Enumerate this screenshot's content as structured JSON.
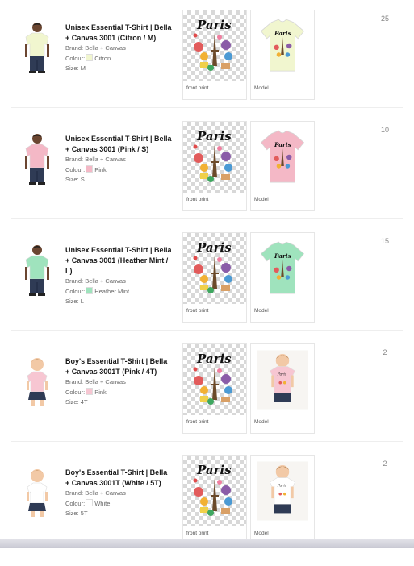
{
  "items": [
    {
      "title": "Unisex Essential T-Shirt | Bella + Canvas 3001 (Citron / M)",
      "brand_label": "Brand:",
      "brand": "Bella + Canvas",
      "colour_label": "Colour:",
      "colour": "Citron",
      "colour_hex": "#f1f6cf",
      "size_label": "Size:",
      "size": "M",
      "print_caption": "front print",
      "model_caption": "Model",
      "quantity": "25",
      "figure": "adult-male"
    },
    {
      "title": "Unisex Essential T-Shirt | Bella + Canvas 3001 (Pink / S)",
      "brand_label": "Brand:",
      "brand": "Bella + Canvas",
      "colour_label": "Colour:",
      "colour": "Pink",
      "colour_hex": "#f4b8c6",
      "size_label": "Size:",
      "size": "S",
      "print_caption": "front print",
      "model_caption": "Model",
      "quantity": "10",
      "figure": "adult-male"
    },
    {
      "title": "Unisex Essential T-Shirt | Bella + Canvas 3001 (Heather Mint / L)",
      "brand_label": "Brand:",
      "brand": "Bella + Canvas",
      "colour_label": "Colour:",
      "colour": "Heather Mint",
      "colour_hex": "#9fe3bd",
      "size_label": "Size:",
      "size": "L",
      "print_caption": "front print",
      "model_caption": "Model",
      "quantity": "15",
      "figure": "adult-male"
    },
    {
      "title": "Boy's Essential T-Shirt | Bella + Canvas 3001T (Pink / 4T)",
      "brand_label": "Brand:",
      "brand": "Bella + Canvas",
      "colour_label": "Colour:",
      "colour": "Pink",
      "colour_hex": "#f7c6d2",
      "size_label": "Size:",
      "size": "4T",
      "print_caption": "front print",
      "model_caption": "Model",
      "quantity": "2",
      "figure": "child"
    },
    {
      "title": "Boy's Essential T-Shirt | Bella + Canvas 3001T (White / 5T)",
      "brand_label": "Brand:",
      "brand": "Bella + Canvas",
      "colour_label": "Colour:",
      "colour": "White",
      "colour_hex": "#ffffff",
      "size_label": "Size:",
      "size": "5T",
      "print_caption": "front print",
      "model_caption": "Model",
      "quantity": "2",
      "figure": "child"
    }
  ],
  "design_text": "Paris",
  "colors": {
    "skin_adult": "#6b4631",
    "skin_child": "#f2c9a6",
    "jeans": "#2f3b55",
    "text_muted": "#666666"
  }
}
